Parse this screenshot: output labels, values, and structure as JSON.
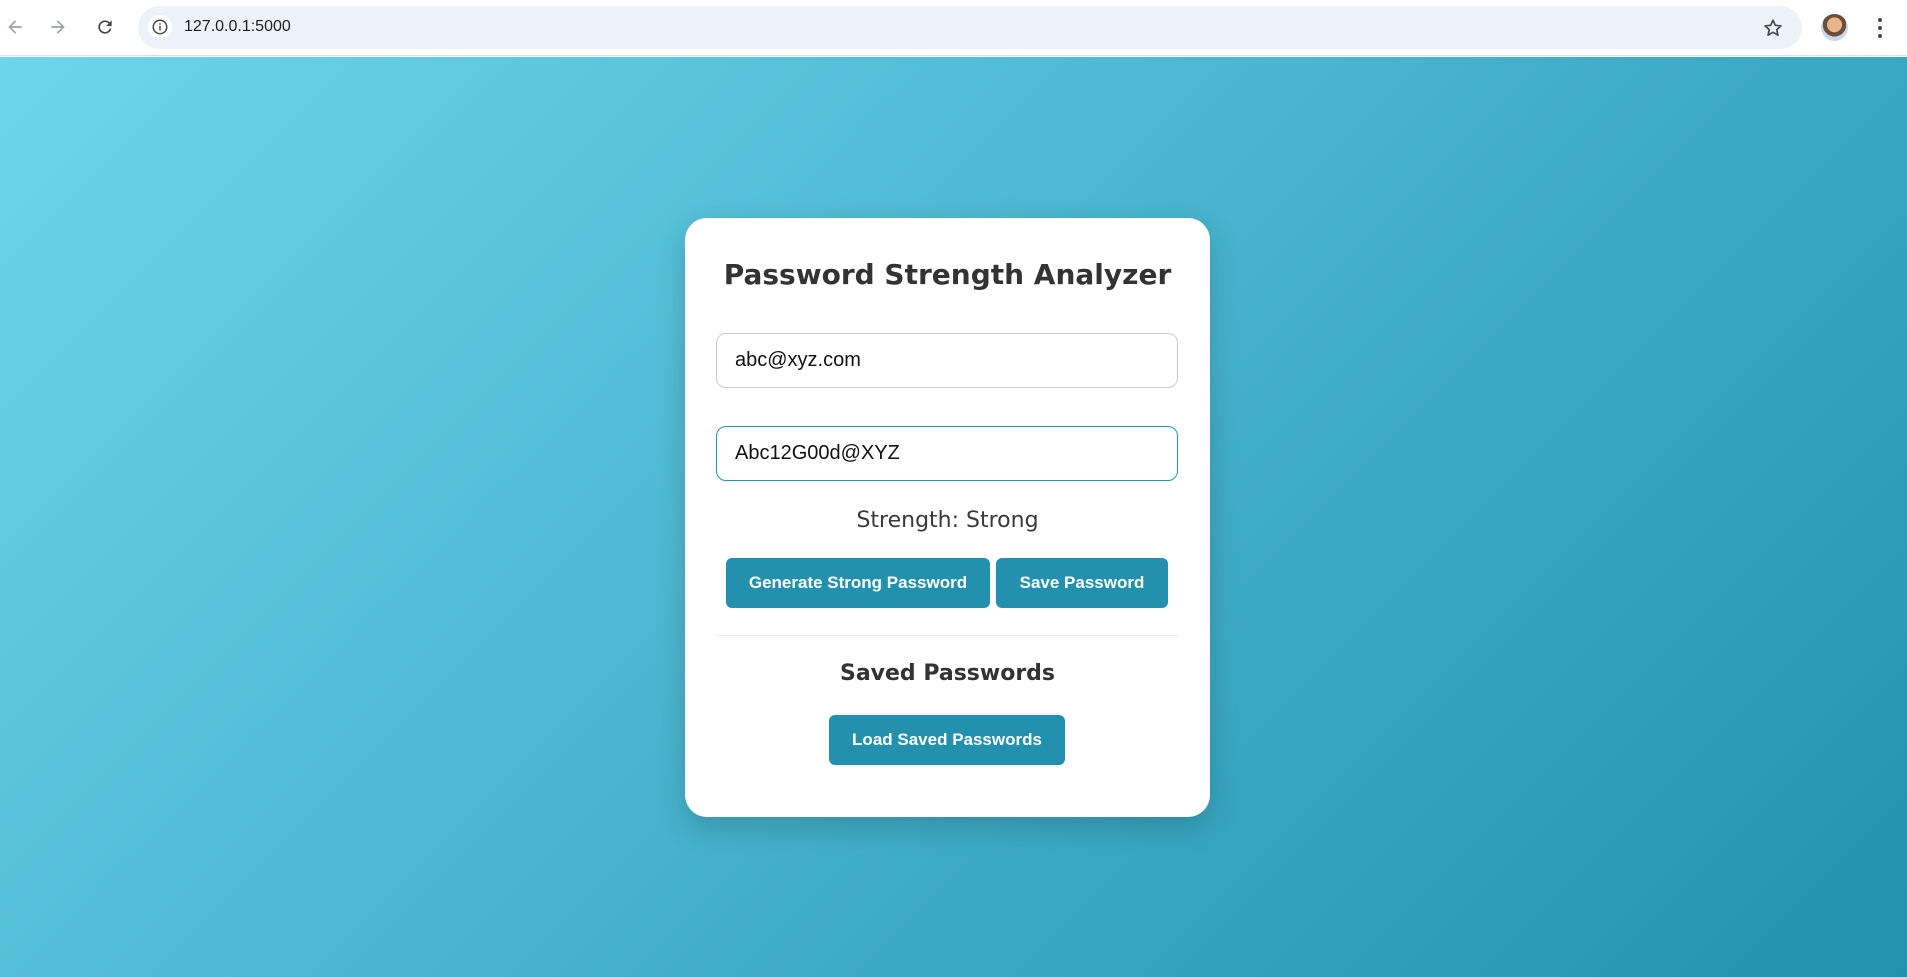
{
  "browser": {
    "url": "127.0.0.1:5000"
  },
  "app": {
    "title": "Password Strength Analyzer",
    "email_value": "abc@xyz.com",
    "password_value": "Abc12G00d@XYZ",
    "strength_text": "Strength: Strong",
    "generate_label": "Generate Strong Password",
    "save_label": "Save Password",
    "saved_heading": "Saved Passwords",
    "load_label": "Load Saved Passwords"
  },
  "colors": {
    "accent": "#2391ad",
    "gradient_start": "#6dd5ed",
    "gradient_end": "#2191ad"
  },
  "icons": [
    "back-arrow-icon",
    "forward-arrow-icon",
    "reload-icon",
    "info-icon",
    "star-icon",
    "avatar",
    "more-menu-icon"
  ]
}
